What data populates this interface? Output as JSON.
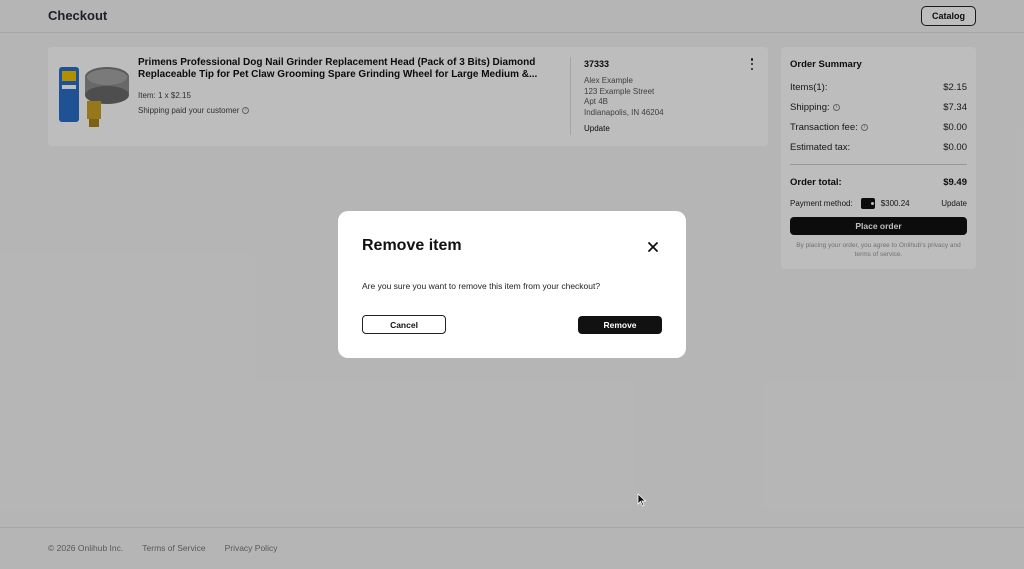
{
  "header": {
    "title": "Checkout",
    "catalog_label": "Catalog"
  },
  "item": {
    "title": "Primens Professional Dog Nail Grinder Replacement Head (Pack of 3 Bits) Diamond Replaceable Tip for Pet Claw Grooming Spare Grinding Wheel for Large Medium &...",
    "qty": "Item: 1 x $2.15",
    "shipping_note": "Shipping paid your customer",
    "order_number": "37333",
    "address": [
      "Alex Example",
      "123 Example Street",
      "Apt 4B",
      "Indianapolis, IN 46204"
    ],
    "update_label": "Update"
  },
  "summary": {
    "title": "Order Summary",
    "rows": [
      {
        "label": "Items(1):",
        "value": "$2.15"
      },
      {
        "label": "Shipping:",
        "value": "$7.34"
      },
      {
        "label": "Transaction fee:",
        "value": "$0.00"
      },
      {
        "label": "Estimated tax:",
        "value": "$0.00"
      }
    ],
    "total": {
      "label": "Order total:",
      "value": "$9.49"
    },
    "payment": {
      "label": "Payment method:",
      "amount": "$300.24",
      "update": "Update"
    },
    "place_order_label": "Place order",
    "legal": "By placing your order, you agree to Onlihub's privacy and terms of service."
  },
  "footer": {
    "copyright": "© 2026 Onlihub Inc.",
    "terms": "Terms of Service",
    "privacy": "Privacy Policy"
  },
  "modal": {
    "title": "Remove item",
    "body": "Are you sure you want to remove this item from your checkout?",
    "cancel_label": "Cancel",
    "remove_label": "Remove"
  },
  "icons": {
    "close": "close-icon",
    "kebab": "kebab-menu-icon",
    "info": "info-icon",
    "wallet": "wallet-icon",
    "cursor": "mouse-cursor-icon"
  },
  "colors": {
    "primary": "#111111",
    "overlay": "rgba(0,0,0,0.26)",
    "background": "#f5f5f5"
  }
}
